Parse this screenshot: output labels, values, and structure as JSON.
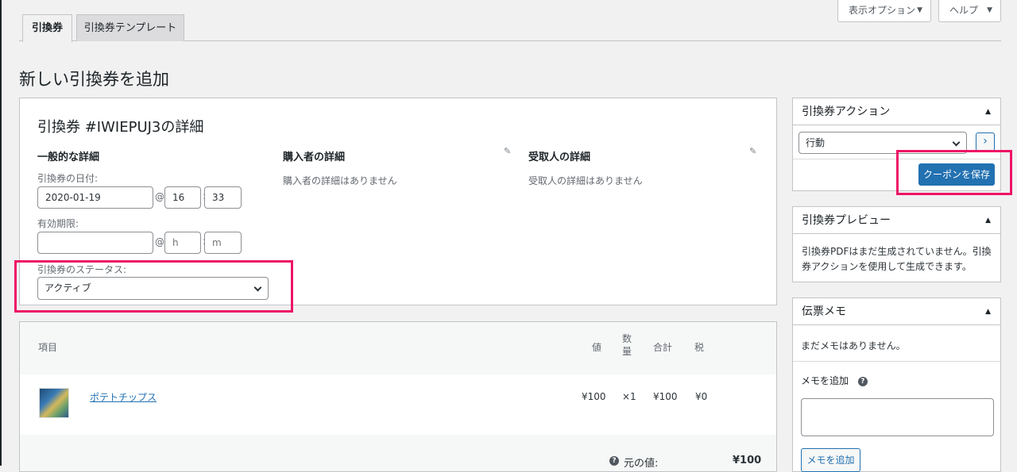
{
  "tabs": [
    {
      "label": "引換券",
      "active": true
    },
    {
      "label": "引換券テンプレート",
      "active": false
    }
  ],
  "screen_options": {
    "label": "表示オプション"
  },
  "help": {
    "label": "ヘルプ"
  },
  "page_title": "新しい引換券を追加",
  "voucher": {
    "title": "引換券 #IWIEPUJ3の詳細",
    "general": {
      "heading": "一般的な詳細",
      "date_label": "引換券の日付:",
      "date": "2020-01-19",
      "hour": "16",
      "minute": "33",
      "expiry_label": "有効期限:",
      "expiry_hour_placeholder": "h",
      "expiry_minute_placeholder": "m",
      "status_label": "引換券のステータス:",
      "status": "アクティブ"
    },
    "buyer": {
      "heading": "購入者の詳細",
      "empty": "購入者の詳細はありません"
    },
    "recipient": {
      "heading": "受取人の詳細",
      "empty": "受取人の詳細はありません"
    }
  },
  "items": {
    "headers": {
      "item": "項目",
      "value": "値",
      "qty": "数量",
      "total": "合計",
      "tax": "税"
    },
    "rows": [
      {
        "name": "ポテトチップス",
        "value": "¥100",
        "qty": "×1",
        "total": "¥100",
        "tax": "¥0"
      }
    ],
    "original_value_label": "元の値:",
    "original_value": "¥100"
  },
  "actions_box": {
    "title": "引換券アクション",
    "select_value": "行動",
    "go_icon": "chevron-right-icon",
    "save_label": "クーポンを保存"
  },
  "preview_box": {
    "title": "引換券プレビュー",
    "text": "引換券PDFはまだ生成されていません。引換券アクションを使用して生成できます。"
  },
  "notes_box": {
    "title": "伝票メモ",
    "empty": "まだメモはありません。",
    "add_label": "メモを追加",
    "add_button": "メモを追加"
  },
  "colors": {
    "accent": "#2271b1",
    "highlight": "#ee1466"
  }
}
